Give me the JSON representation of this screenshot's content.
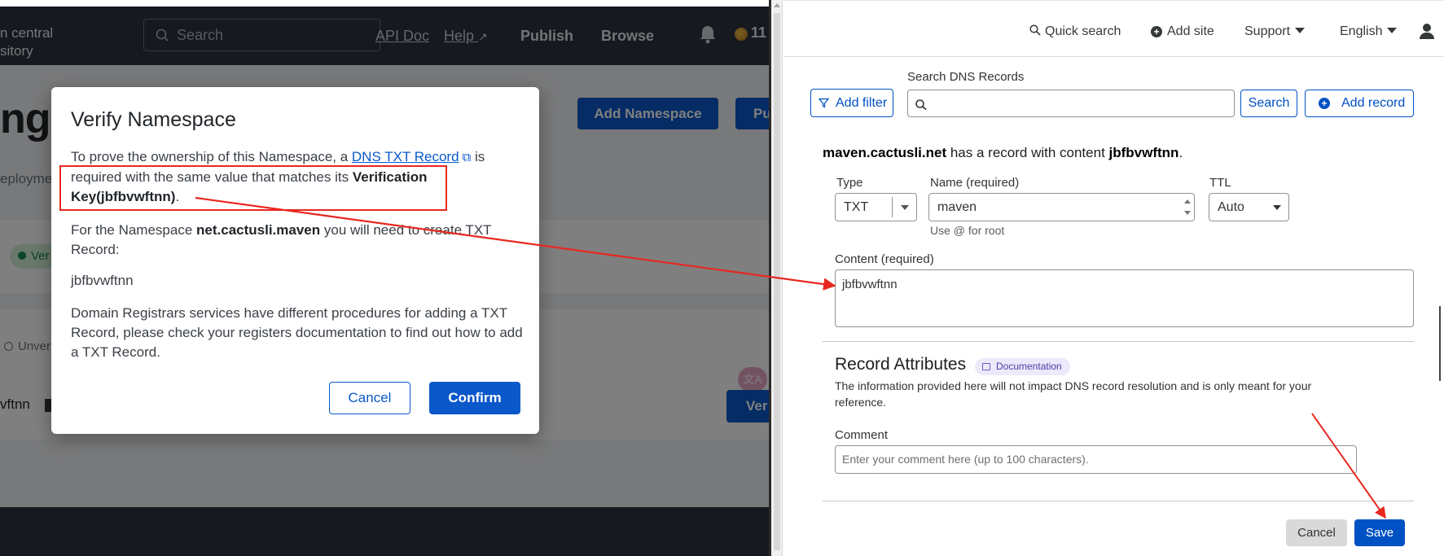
{
  "maven": {
    "brand_line1": "n central",
    "brand_line2": "sitory",
    "search_placeholder": "Search",
    "nav": {
      "api_doc": "API Doc",
      "help": "Help",
      "publish": "Publish",
      "browse": "Browse",
      "user_count": "11"
    },
    "page_title": "ng",
    "deployments_text": "eploymen",
    "add_namespace": "Add Namespace",
    "p_button": "Pu",
    "verified_badge": "Ver",
    "unverified_badge": "Unver",
    "key_fragment": "vftnn",
    "verify_button": "Ver",
    "translate_badge": "文A"
  },
  "modal": {
    "title": "Verify Namespace",
    "p1_pre": "To prove the ownership of this Namespace, a ",
    "p1_link": "DNS TXT Record",
    "p1_mid": " is required with the same value that matches its ",
    "p1_bold": "Verification Key(jbfbvwftnn)",
    "p1_end": ".",
    "p2_pre": "For the Namespace ",
    "p2_bold": "net.cactusli.maven",
    "p2_post": " you will need to create TXT Record:",
    "key_value": "jbfbvwftnn",
    "p4": "Domain Registrars services have different procedures for adding a TXT Record, please check your registers documentation to find out how to add a TXT Record.",
    "cancel": "Cancel",
    "confirm": "Confirm"
  },
  "cloudflare": {
    "header": {
      "quick_search": "Quick search",
      "add_site": "Add site",
      "support": "Support",
      "language": "English"
    },
    "search_label": "Search DNS Records",
    "add_filter": "Add filter",
    "search_button": "Search",
    "add_record": "Add record",
    "summary_domain": "maven.cactusli.net",
    "summary_mid": " has a record with content ",
    "summary_content": "jbfbvwftnn",
    "summary_end": ".",
    "type_label": "Type",
    "type_value": "TXT",
    "name_label": "Name (required)",
    "name_value": "maven",
    "name_hint": "Use @ for root",
    "ttl_label": "TTL",
    "ttl_value": "Auto",
    "content_label": "Content (required)",
    "content_value": "jbfbvwftnn",
    "attr_title": "Record Attributes",
    "doc_badge": "Documentation",
    "attr_desc": "The information provided here will not impact DNS record resolution and is only meant for your reference.",
    "comment_label": "Comment",
    "comment_placeholder": "Enter your comment here (up to 100 characters).",
    "cancel": "Cancel",
    "save": "Save"
  },
  "colors": {
    "maven_nav": "#2d3340",
    "maven_primary": "#0a58ca",
    "cloudflare_primary": "#0051c3",
    "annotation_red": "#e8271f"
  }
}
